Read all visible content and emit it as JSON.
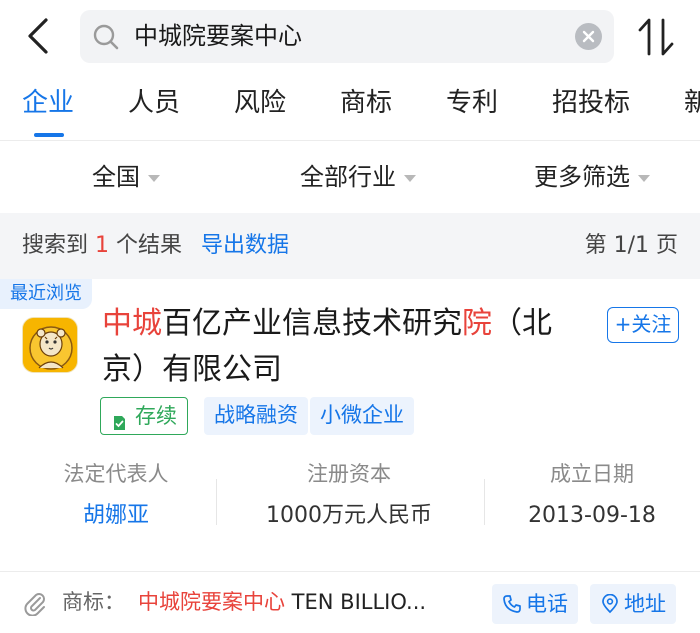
{
  "search": {
    "query": "中城院要案中心"
  },
  "tabs": [
    {
      "label": "企业",
      "active": true
    },
    {
      "label": "人员",
      "active": false
    },
    {
      "label": "风险",
      "active": false
    },
    {
      "label": "商标",
      "active": false
    },
    {
      "label": "专利",
      "active": false
    },
    {
      "label": "招投标",
      "active": false
    },
    {
      "label": "新",
      "active": false
    }
  ],
  "filters": {
    "region": "全国",
    "industry": "全部行业",
    "more": "更多筛选"
  },
  "results": {
    "prefix": "搜索到",
    "count": "1",
    "suffix": "个结果",
    "export_label": "导出数据",
    "page_info": "第 1/1 页"
  },
  "company": {
    "recent_tag": "最近浏览",
    "name_hl1": "中城",
    "name_mid": "百亿产业信息技术研究",
    "name_hl2": "院",
    "name_tail": "（北京）有限公司",
    "follow_label": "+关注",
    "tags": {
      "status": "存续",
      "tag2": "战略融资",
      "tag3": "小微企业"
    },
    "legal_rep_label": "法定代表人",
    "legal_rep": "胡娜亚",
    "capital_label": "注册资本",
    "capital": "1000万元人民币",
    "founded_label": "成立日期",
    "founded": "2013-09-18"
  },
  "trademark": {
    "label": "商标：",
    "value_hl": "中城院要案中心",
    "value_rest": " TEN BILLIO...",
    "phone_label": "电话",
    "address_label": "地址"
  },
  "colors": {
    "accent": "#1676e8",
    "highlight": "#e8433b",
    "status_green": "#2fa85a"
  },
  "icons": [
    "back-arrow-icon",
    "search-icon",
    "clear-icon",
    "sort-icon",
    "caret-down-icon",
    "check-icon",
    "paperclip-icon",
    "phone-icon",
    "location-pin-icon"
  ]
}
